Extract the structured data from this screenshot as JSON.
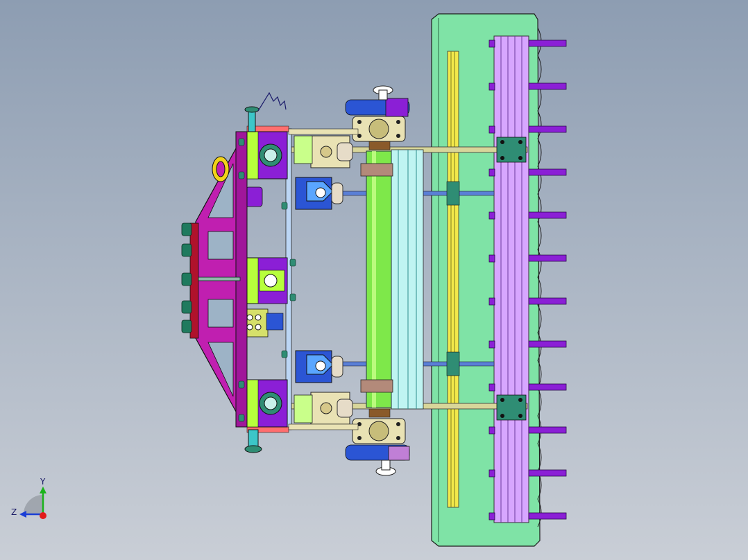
{
  "axis_triad": {
    "y_label": "Y",
    "z_label": "Z"
  },
  "colors": {
    "background_top": "#8d9db2",
    "background_bottom": "#c9ced6",
    "base_plate": "#7fe3a6",
    "magenta_frame": "#c01fb0",
    "purple_block": "#8b1fd6",
    "lime_block": "#b7ff3c",
    "roller": "#7ee84a",
    "lavender_rail": "#d7a6ff",
    "cyan_shaft": "#3cc6c8",
    "blue_link": "#2b55d4",
    "tan_bracket": "#e9e2b4"
  }
}
